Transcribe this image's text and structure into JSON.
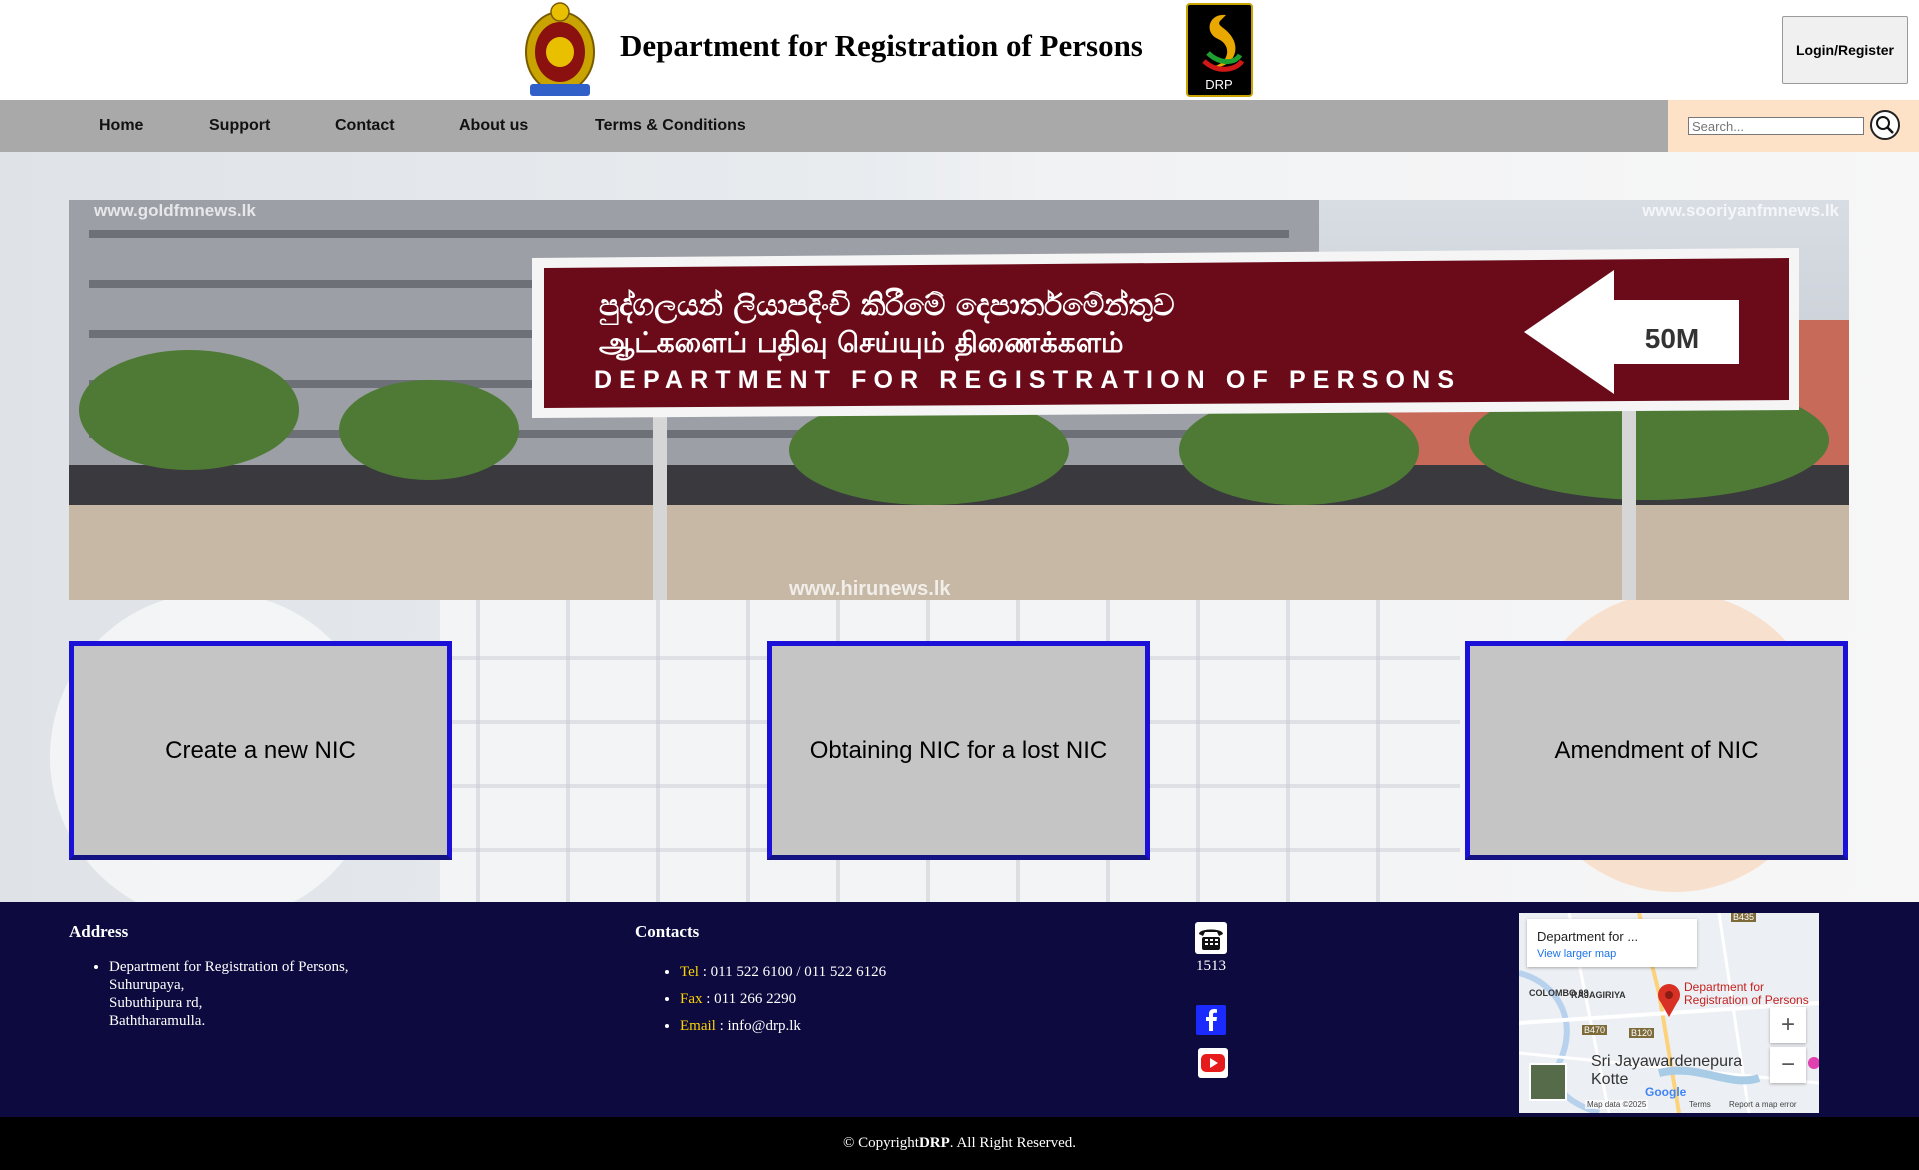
{
  "header": {
    "title": "Department for Registration of Persons",
    "logo_text": "DRP",
    "login_label": "Login/Register"
  },
  "nav": {
    "items": [
      {
        "label": "Home"
      },
      {
        "label": "Support"
      },
      {
        "label": "Contact"
      },
      {
        "label": "About us"
      },
      {
        "label": "Terms & Conditions"
      }
    ],
    "search_placeholder": "Search...",
    "search_icon": "search-icon"
  },
  "hero": {
    "sign_sinhala": "පුද්ගලයන් ලියාපදිංචි කිරීමේ දෙපාර්තමේන්තුව",
    "sign_tamil": "ஆட்களைப் பதிவு செய்யும் திணைக்களம்",
    "sign_english": "DEPARTMENT FOR REGISTRATION OF PERSONS",
    "sign_distance": "50M",
    "watermark_left": "www.goldfmnews.lk",
    "watermark_right": "www.sooriyanfmnews.lk",
    "watermark_bottom": "www.hirunews.lk"
  },
  "services": [
    {
      "label": "Create a new NIC"
    },
    {
      "label": "Obtaining NIC for a lost NIC"
    },
    {
      "label": "Amendment of NIC"
    }
  ],
  "footer": {
    "address_heading": "Address",
    "address_lines": [
      "Department for Registration of Persons,",
      "Suhurupaya,",
      "Subuthipura rd,",
      "Baththaramulla."
    ],
    "contacts_heading": "Contacts",
    "contacts": [
      {
        "key": "Tel",
        "value": " : 011 522 6100 / 011 522 6126"
      },
      {
        "key": "Fax",
        "value": " : 011 266 2290"
      },
      {
        "key": "Email",
        "value": " : info@drp.lk"
      }
    ],
    "hotline": "1513",
    "map": {
      "card_title": "Department for ...",
      "card_link": "View larger map",
      "place_label": "Department for Registration of Persons",
      "area_colombo": "COLOMBO 08",
      "area_rajagiriya": "RAJAGIRIYA",
      "city_line1": "Sri Jayawardenepura",
      "city_line2": "Kotte",
      "brand": "Google",
      "attribution": "Map data ©2025",
      "terms": "Terms",
      "report": "Report a map error",
      "road_b435": "B435",
      "road_b470": "B470",
      "road_b120": "B120",
      "zoom_in": "+",
      "zoom_out": "−"
    }
  },
  "copyright": {
    "prefix": "© Copyright ",
    "brand": "DRP",
    "suffix": ". All Right Reserved."
  }
}
